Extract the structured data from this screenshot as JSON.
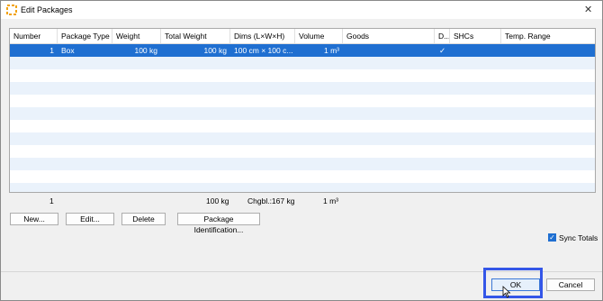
{
  "window": {
    "title": "Edit Packages"
  },
  "grid": {
    "headers": [
      "Number",
      "Package Type",
      "Weight",
      "Total Weight",
      "Dims (L×W×H)",
      "Volume",
      "Goods",
      "D...",
      "SHCs",
      "Temp. Range"
    ],
    "rows": [
      {
        "number": "1",
        "package_type": "Box",
        "weight": "100 kg",
        "total_weight": "100 kg",
        "dims": "100 cm × 100 c...",
        "volume": "1 m³",
        "goods": "",
        "d": "✓",
        "shcs": "",
        "temp": ""
      }
    ]
  },
  "totals": {
    "number": "1",
    "total_weight": "100 kg",
    "chargeable": "Chgbl.:167 kg",
    "volume": "1 m³"
  },
  "buttons": {
    "new": "New...",
    "edit": "Edit...",
    "delete": "Delete",
    "package_identification": "Package Identification..."
  },
  "sync_totals": {
    "label": "Sync Totals",
    "checked": true
  },
  "footer": {
    "ok": "OK",
    "cancel": "Cancel"
  },
  "colors": {
    "selection": "#1f6fd1",
    "alt_row": "#eaf2fb",
    "focus_highlight": "#3456e8"
  }
}
